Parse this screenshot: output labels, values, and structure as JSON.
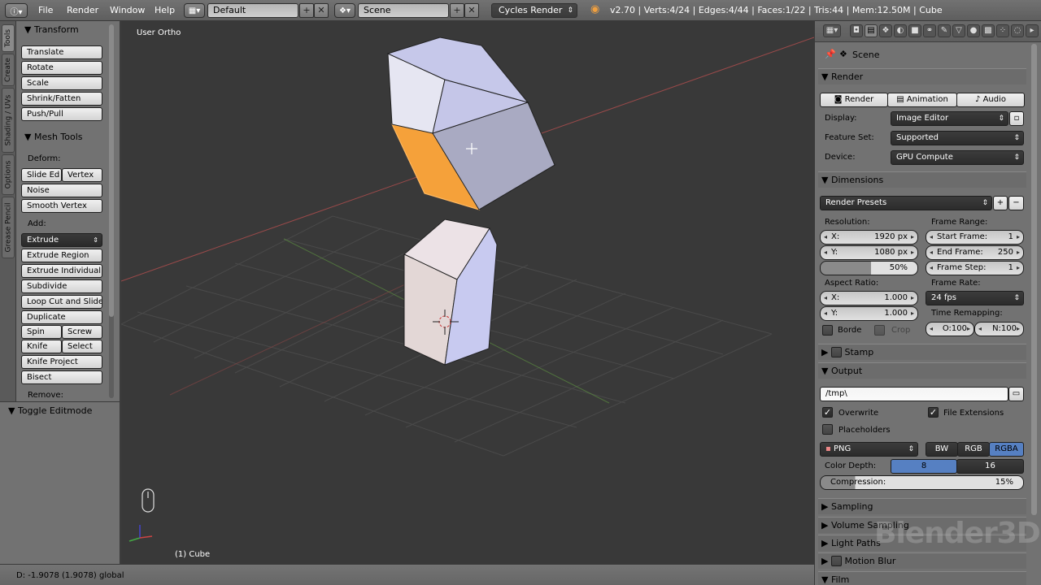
{
  "menu": {
    "file": "File",
    "render": "Render",
    "window": "Window",
    "help": "Help",
    "screen_layout": "Default",
    "scene": "Scene",
    "engine": "Cycles Render",
    "stats": "v2.70 | Verts:4/24 | Edges:4/44 | Faces:1/22 | Tris:44 | Mem:12.50M | Cube"
  },
  "tabs": [
    "Tools",
    "Create",
    "Shading / UVs",
    "Options",
    "Grease Pencil"
  ],
  "toolshelf": {
    "transform_header": "Transform",
    "translate": "Translate",
    "rotate": "Rotate",
    "scale": "Scale",
    "shrink_fatten": "Shrink/Fatten",
    "push_pull": "Push/Pull",
    "mesh_tools_header": "Mesh Tools",
    "deform_label": "Deform:",
    "slide_edge": "Slide Ed",
    "vertex": "Vertex",
    "noise": "Noise",
    "smooth_vertex": "Smooth Vertex",
    "add_label": "Add:",
    "extrude": "Extrude",
    "extrude_region": "Extrude Region",
    "extrude_individual": "Extrude Individual",
    "subdivide": "Subdivide",
    "loop_cut_slide": "Loop Cut and Slide",
    "duplicate": "Duplicate",
    "spin": "Spin",
    "screw": "Screw",
    "knife": "Knife",
    "select": "Select",
    "knife_project": "Knife Project",
    "bisect": "Bisect",
    "remove_label": "Remove:"
  },
  "operator": {
    "header": "Toggle Editmode"
  },
  "viewport": {
    "view_label": "User Ortho",
    "object_label": "(1) Cube"
  },
  "status": {
    "text": "D: -1.9078 (1.9078) global"
  },
  "properties": {
    "context": "Scene",
    "render_header": "Render",
    "render_btn": "Render",
    "animation_btn": "Animation",
    "audio_btn": "Audio",
    "display_label": "Display:",
    "display_value": "Image Editor",
    "feature_set_label": "Feature Set:",
    "feature_set_value": "Supported",
    "device_label": "Device:",
    "device_value": "GPU Compute",
    "dimensions_header": "Dimensions",
    "render_presets": "Render Presets",
    "resolution_label": "Resolution:",
    "res_x_label": "X:",
    "res_x_value": "1920 px",
    "res_y_label": "Y:",
    "res_y_value": "1080 px",
    "res_percent": "50%",
    "frame_range_label": "Frame Range:",
    "start_frame_label": "Start Frame:",
    "start_frame_value": "1",
    "end_frame_label": "End Frame:",
    "end_frame_value": "250",
    "frame_step_label": "Frame Step:",
    "frame_step_value": "1",
    "aspect_label": "Aspect Ratio:",
    "aspect_x_label": "X:",
    "aspect_x_value": "1.000",
    "aspect_y_label": "Y:",
    "aspect_y_value": "1.000",
    "frame_rate_label": "Frame Rate:",
    "frame_rate_value": "24 fps",
    "time_remap_label": "Time Remapping:",
    "time_old": "O:100",
    "time_new": "N:100",
    "border_label": "Borde",
    "crop_label": "Crop",
    "stamp_header": "Stamp",
    "output_header": "Output",
    "output_path": "/tmp\\",
    "overwrite_label": "Overwrite",
    "file_ext_label": "File Extensions",
    "placeholders_label": "Placeholders",
    "format_value": "PNG",
    "bw": "BW",
    "rgb": "RGB",
    "rgba": "RGBA",
    "color_depth_label": "Color Depth:",
    "depth_8": "8",
    "depth_16": "16",
    "compression_label": "Compression:",
    "compression_value": "15%",
    "sampling_header": "Sampling",
    "volume_sampling_header": "Volume Sampling",
    "light_paths_header": "Light Paths",
    "motion_blur_header": "Motion Blur",
    "film_header": "Film"
  },
  "watermark": "Blender3D",
  "colors": {
    "accent_blue": "#5680c2",
    "selection_orange": "#f5a13a"
  }
}
